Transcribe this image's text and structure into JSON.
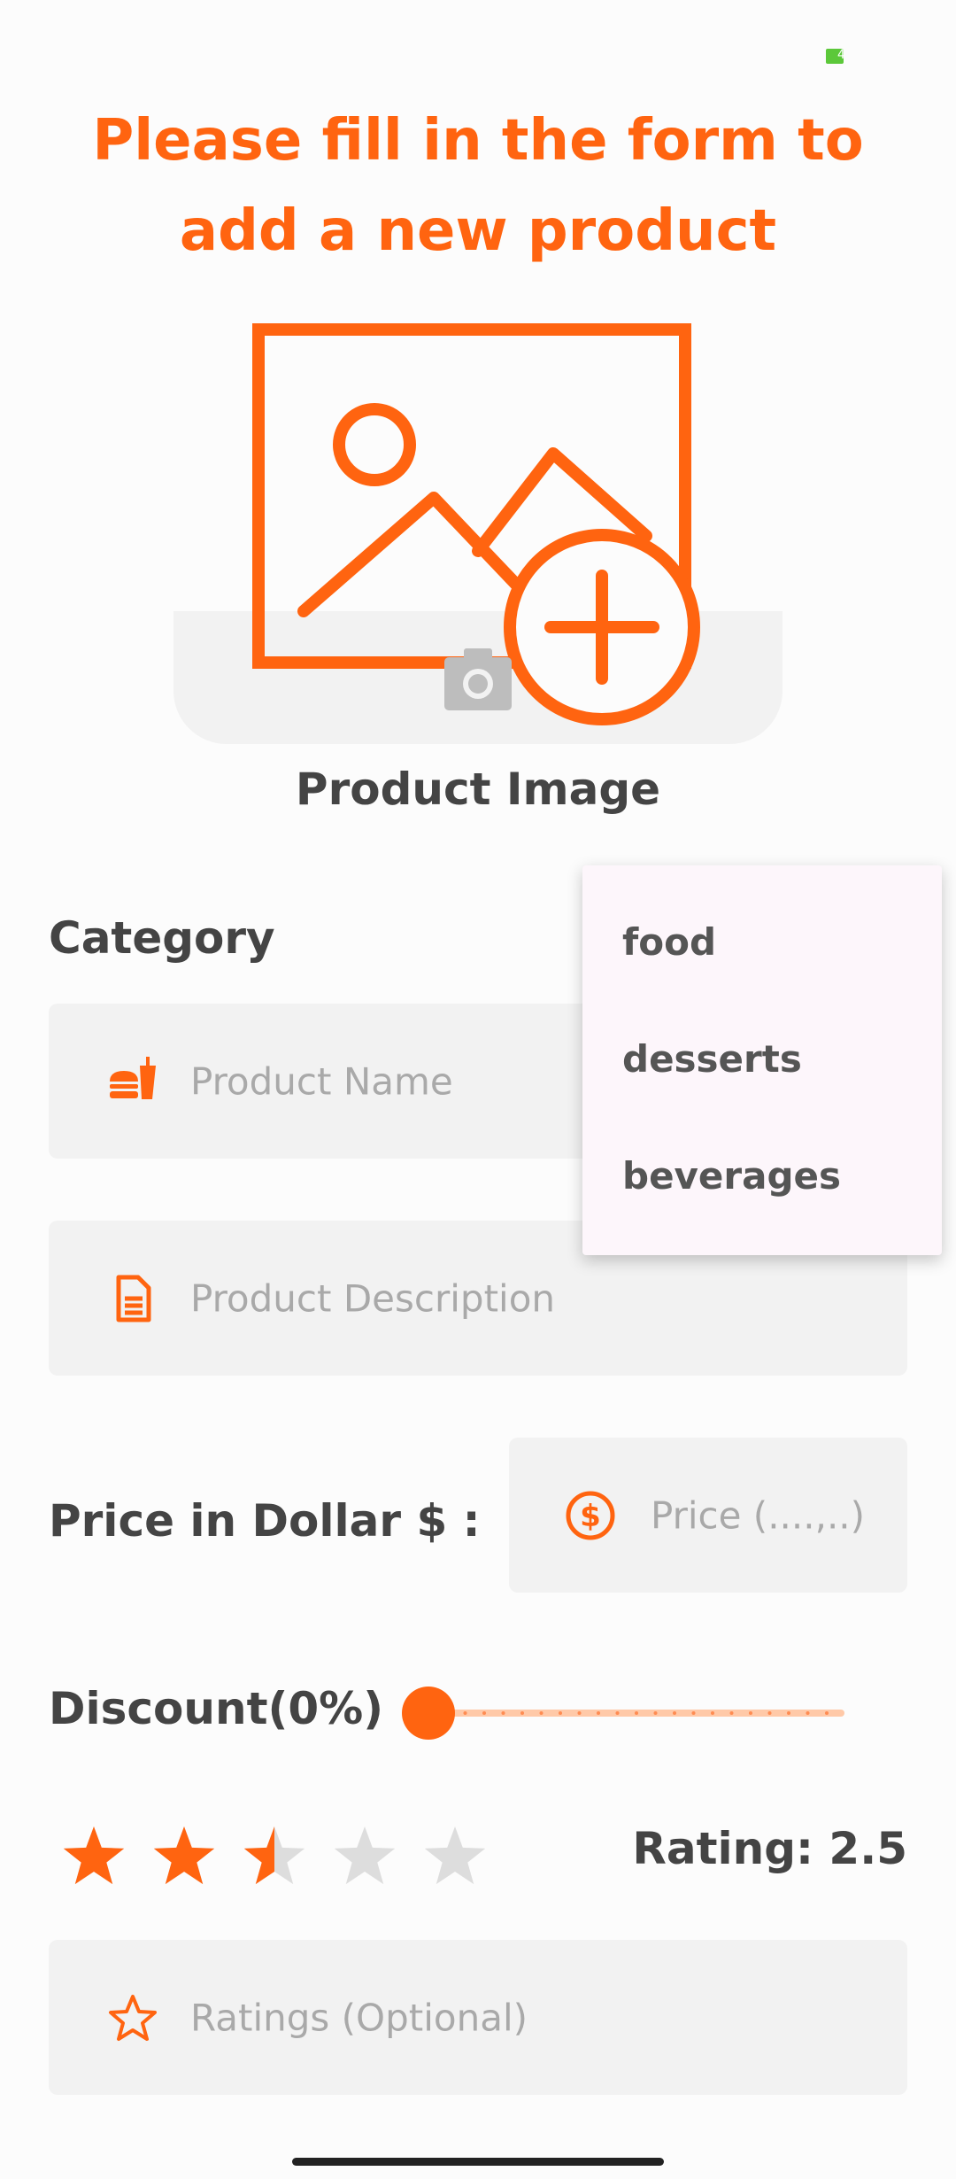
{
  "status_bar": {
    "battery_text": "4"
  },
  "title": "Please fill in the form to add a new product",
  "product_image": {
    "label": "Product Image"
  },
  "category": {
    "label": "Category"
  },
  "dropdown": {
    "options": [
      "food",
      "desserts",
      "beverages"
    ]
  },
  "fields": {
    "product_name": {
      "placeholder": "Product Name",
      "icon": "fast-food-icon"
    },
    "product_description": {
      "placeholder": "Product Description",
      "icon": "document-icon"
    },
    "price": {
      "label": "Price in Dollar $ :",
      "placeholder": "Price (....,..)",
      "icon": "dollar-circle-icon"
    },
    "ratings": {
      "placeholder": "Ratings (Optional)",
      "icon": "star-outline-icon"
    }
  },
  "discount": {
    "label": "Discount(0%)",
    "value_fraction": 0
  },
  "rating": {
    "label": "Rating: 2.5",
    "value": 2.5,
    "max": 5
  },
  "colors": {
    "accent": "#ff6410",
    "field_bg": "#f2f2f2",
    "text": "#444444",
    "placeholder": "#a9a9a9",
    "star_empty": "#dddddd"
  }
}
